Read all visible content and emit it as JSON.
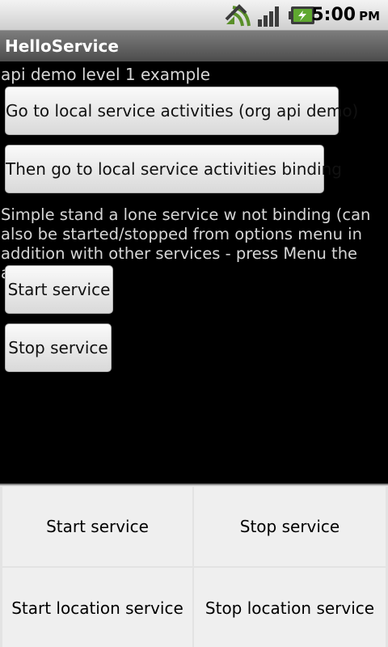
{
  "status_bar": {
    "time": "5:00",
    "ampm": "PM",
    "icons": [
      "wifi-icon",
      "signal-icon",
      "battery-charging-icon"
    ]
  },
  "app": {
    "title": "HelloService"
  },
  "content": {
    "heading": "api demo level 1 example",
    "button_local_activities": "Go to local service activities (org api demo)",
    "button_local_binding": "Then go to local service activities binding",
    "description": "Simple stand a lone service w not binding (can also be started/stopped from options menu in addition with other services - press Menu the android way)",
    "button_start": "Start service",
    "button_stop": "Stop service"
  },
  "options_menu": {
    "items": [
      {
        "label": "Start service"
      },
      {
        "label": "Stop service"
      },
      {
        "label": "Start location service"
      },
      {
        "label": "Stop location service"
      }
    ]
  }
}
